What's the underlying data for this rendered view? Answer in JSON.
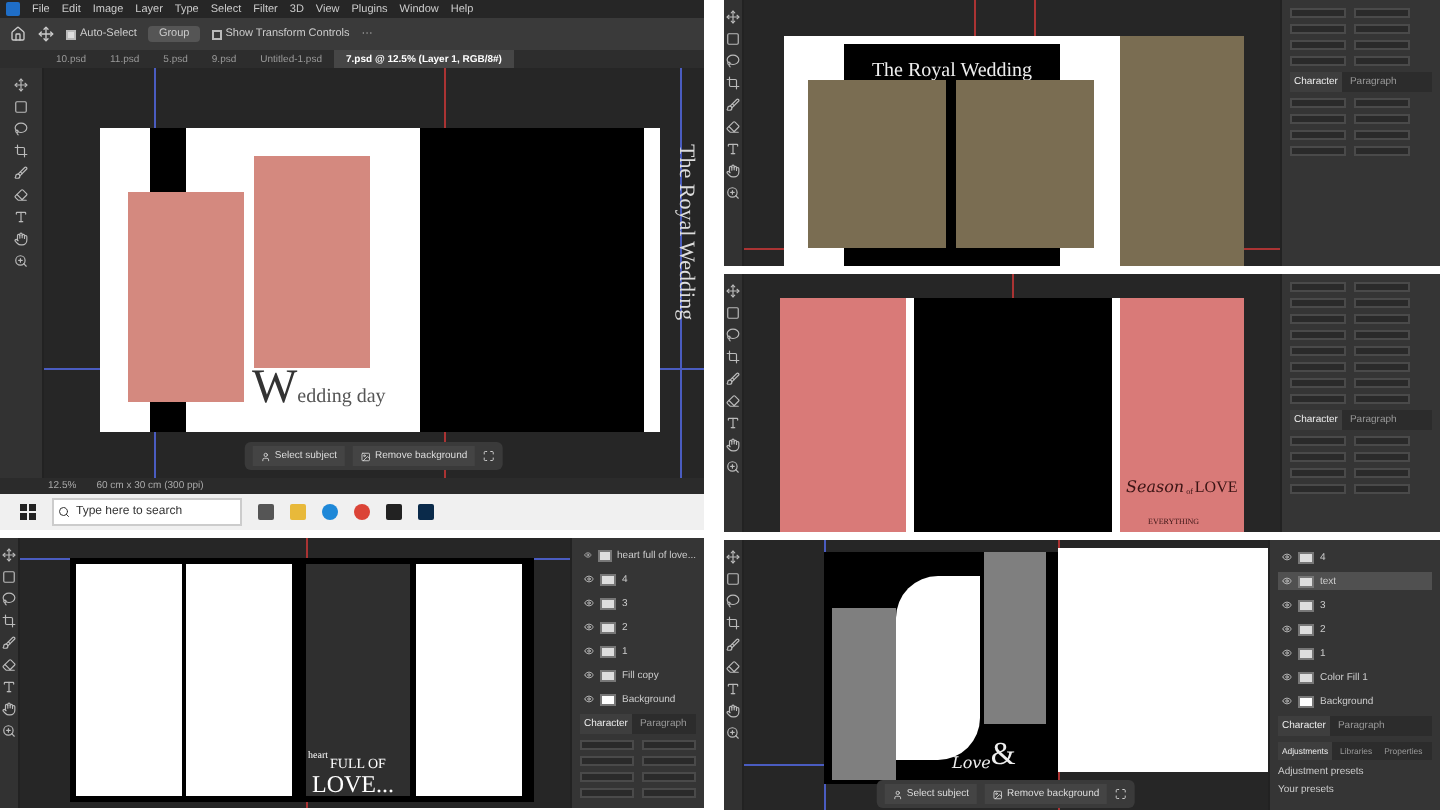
{
  "screens": [
    {
      "kind": "wedding_day",
      "menu": [
        "File",
        "Edit",
        "Image",
        "Layer",
        "Type",
        "Select",
        "Filter",
        "3D",
        "View",
        "Plugins",
        "Window",
        "Help"
      ],
      "options": [
        {
          "label": "Auto-Select",
          "checked": true
        },
        {
          "label": "Show Transform Controls",
          "checked": false
        }
      ],
      "group_select": "Group",
      "more": "···",
      "tabs": [
        {
          "label": "10.psd",
          "selected": false
        },
        {
          "label": "11.psd",
          "selected": false
        },
        {
          "label": "5.psd",
          "selected": false
        },
        {
          "label": "9.psd",
          "selected": false
        },
        {
          "label": "Untitled-1.psd",
          "selected": false
        },
        {
          "label": "7.psd @ 12.5% (Layer 1, RGB/8#)",
          "selected": true
        }
      ],
      "vertical_title": "The Royal Wedding",
      "heading_initial": "W",
      "heading_rest": "edding day",
      "context_actions": [
        "Select subject",
        "Remove background"
      ],
      "zoom": "12.5%",
      "doc_size": "60 cm x 30 cm (300 ppi)",
      "taskbar_search": {
        "placeholder": "Type here to search"
      }
    },
    {
      "kind": "royal_wedding",
      "title": "The Royal Wedding",
      "panel_tabs": [
        {
          "label": "Character",
          "selected": true
        },
        {
          "label": "Paragraph",
          "selected": false
        }
      ]
    },
    {
      "kind": "season_love",
      "script": "Season",
      "small": "of",
      "big": "LOVE",
      "sub": "EVERYTHING",
      "panel_tabs": [
        {
          "label": "Character",
          "selected": true
        },
        {
          "label": "Paragraph",
          "selected": false
        }
      ]
    },
    {
      "kind": "full_of_love",
      "small": "heart",
      "line1": "FULL OF",
      "big": "LOVE...",
      "layers": [
        {
          "name": "heart full of love...",
          "selected": false
        },
        {
          "name": "4",
          "selected": false
        },
        {
          "name": "3",
          "selected": false
        },
        {
          "name": "2",
          "selected": false
        },
        {
          "name": "1",
          "selected": false
        },
        {
          "name": "Fill copy",
          "selected": false
        },
        {
          "name": "Background",
          "selected": false
        }
      ],
      "panel_tabs": [
        {
          "label": "Character",
          "selected": true
        },
        {
          "label": "Paragraph",
          "selected": false
        }
      ]
    },
    {
      "kind": "love_and",
      "script": "Love",
      "amp": "&",
      "layers": [
        {
          "name": "4",
          "selected": false
        },
        {
          "name": "text",
          "selected": true
        },
        {
          "name": "3",
          "selected": false
        },
        {
          "name": "2",
          "selected": false
        },
        {
          "name": "1",
          "selected": false
        },
        {
          "name": "Color Fill 1",
          "selected": false
        },
        {
          "name": "Background",
          "selected": false
        }
      ],
      "panel_tabs": [
        {
          "label": "Character",
          "selected": true
        },
        {
          "label": "Paragraph",
          "selected": false
        }
      ],
      "adjust_tabs": [
        {
          "label": "Adjustments",
          "selected": true
        },
        {
          "label": "Libraries",
          "selected": false
        },
        {
          "label": "Properties",
          "selected": false
        }
      ],
      "adjust_items": [
        "Adjustment presets",
        "Your presets"
      ],
      "context_actions": [
        "Select subject",
        "Remove background"
      ]
    }
  ]
}
